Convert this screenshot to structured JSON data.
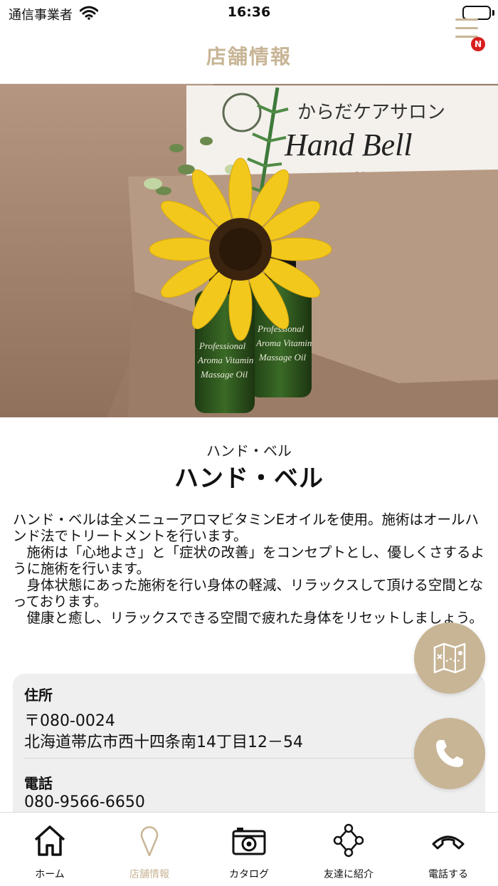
{
  "status_bar": {
    "carrier": "通信事業者",
    "time": "16:36"
  },
  "header": {
    "title": "店舗情報",
    "notification_badge": "N"
  },
  "hero_image": {
    "sign_line1": "からだケアサロン",
    "sign_line2": "Hand Bell",
    "sign_line3": "ハンド・ベル",
    "bottle_text_line1": "Professional",
    "bottle_text_line2": "Aroma Vitamin",
    "bottle_text_line3": "Massage Oil"
  },
  "shop": {
    "name_kana": "ハンド・ベル",
    "name": "ハンド・ベル",
    "description": "ハンド・ベルは全メニューアロマビタミンEオイルを使用。施術はオールハンド法でトリートメントを行います。\n　施術は「心地よさ」と「症状の改善」をコンセプトとし、優しくさするように施術を行います。\n　身体状態にあった施術を行い身体の軽減、リラックスして頂ける空間となっております。\n　健康と癒し、リラックスできる空間で疲れた身体をリセットしましょう。"
  },
  "info": {
    "address_label": "住所",
    "postal_code": "〒080-0024",
    "address": "北海道帯広市西十四条南14丁目12－54",
    "phone_label": "電話",
    "phone": "080-9566-6650"
  },
  "tabs": [
    {
      "label": "ホーム",
      "icon": "home-icon",
      "active": false
    },
    {
      "label": "店舗情報",
      "icon": "location-pin-icon",
      "active": true
    },
    {
      "label": "カタログ",
      "icon": "camera-icon",
      "active": false
    },
    {
      "label": "友達に紹介",
      "icon": "share-icon",
      "active": false
    },
    {
      "label": "電話する",
      "icon": "phone-icon",
      "active": false
    }
  ],
  "colors": {
    "accent": "#c8b596",
    "badge": "#d81e1e",
    "card_background": "#efefef"
  }
}
